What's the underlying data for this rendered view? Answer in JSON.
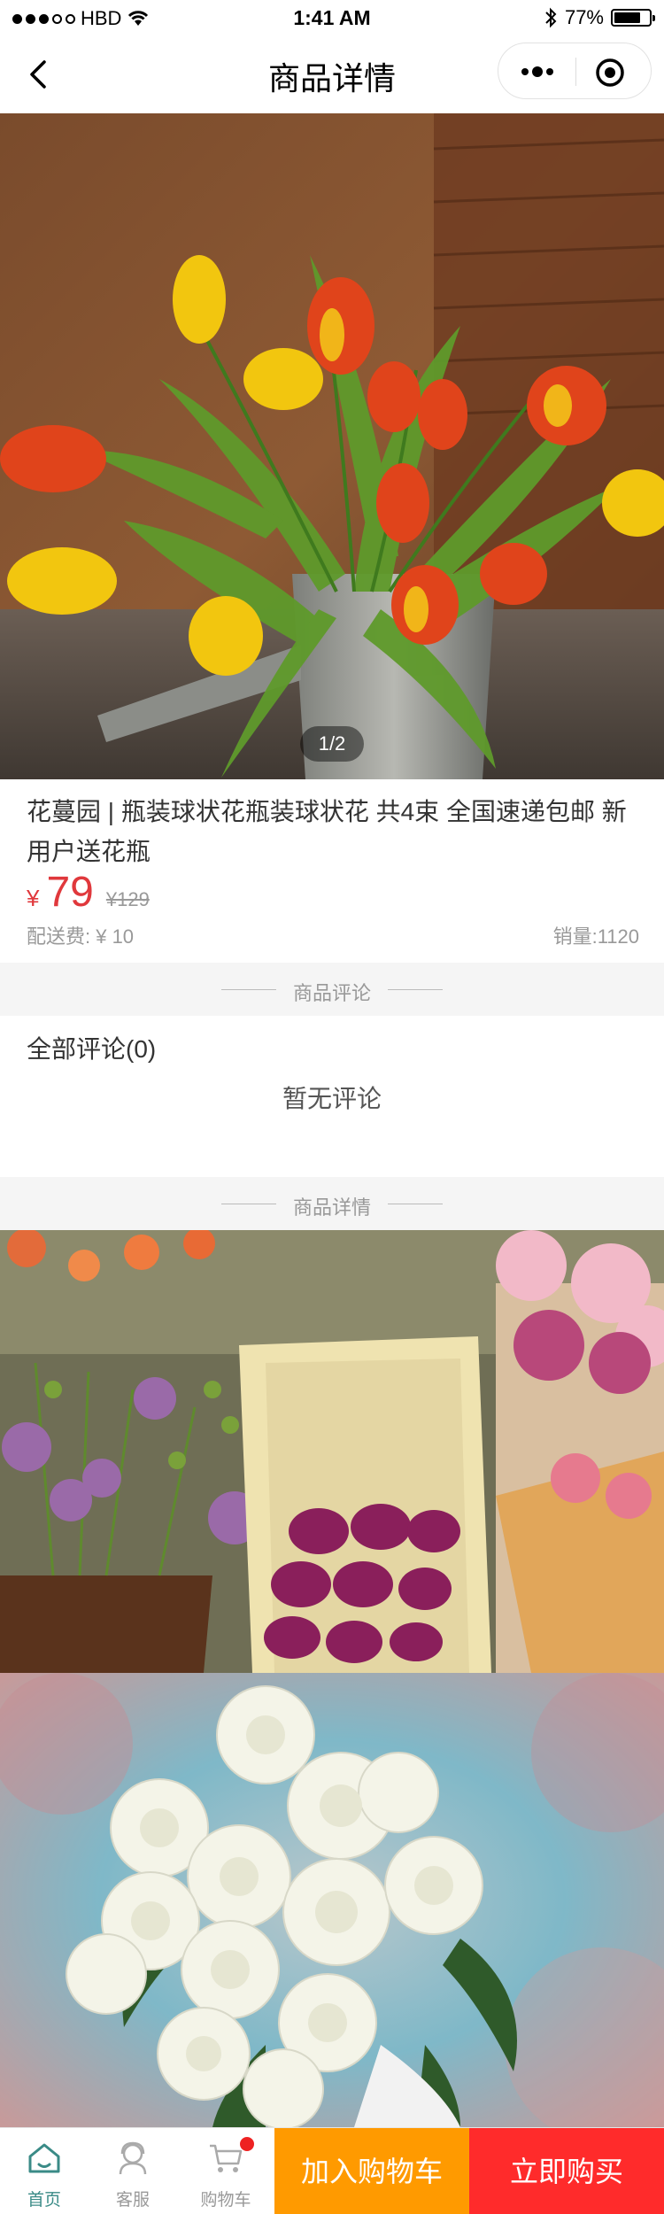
{
  "status": {
    "carrier": "HBD",
    "time": "1:41 AM",
    "battery": "77%",
    "battery_level": 0.77
  },
  "nav": {
    "title": "商品详情"
  },
  "gallery": {
    "counter": "1/2"
  },
  "product": {
    "title": "花蔓园 | 瓶装球状花瓶装球状花 共4束 全国速递包邮 新用户送花瓶",
    "currency": "¥",
    "price": "79",
    "original_price": "¥129",
    "shipping": "配送费: ¥ 10",
    "sales": "销量:1120"
  },
  "reviews": {
    "section_label": "商品评论",
    "all_label": "全部评论(0)",
    "empty_text": "暂无评论"
  },
  "details": {
    "section_label": "商品详情"
  },
  "tabbar": {
    "home": "首页",
    "service": "客服",
    "cart": "购物车",
    "add_to_cart": "加入购物车",
    "buy_now": "立即购买"
  },
  "colors": {
    "price": "#e0383c",
    "add_to_cart_bg": "#ff9a00",
    "buy_now_bg": "#ff2b2b",
    "home_active": "#3a8b87"
  }
}
